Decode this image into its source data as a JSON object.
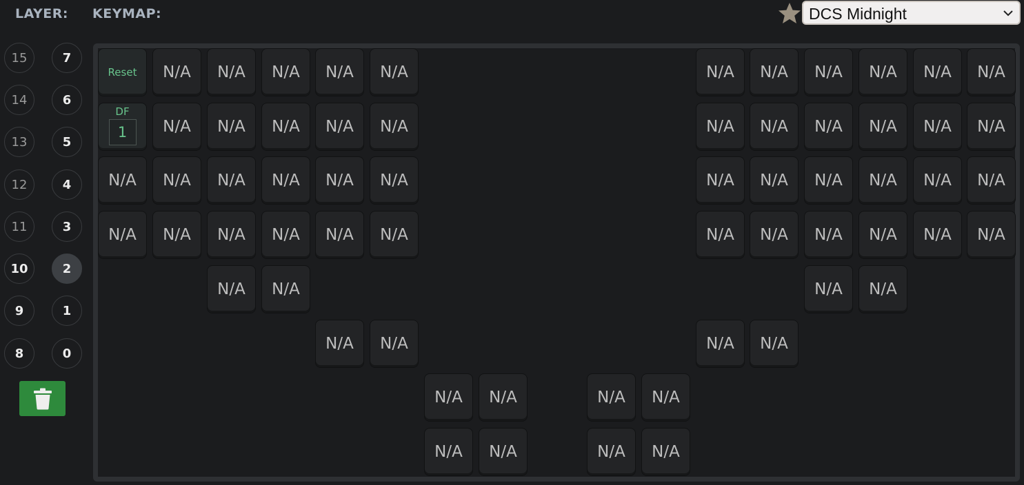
{
  "header": {
    "layer_title": "LAYER:",
    "keymap_title": "KEYMAP:",
    "favorite_icon": "star-icon",
    "theme_selected": "DCS Midnight"
  },
  "layers": {
    "right_column": [
      "7",
      "6",
      "5",
      "4",
      "3",
      "2",
      "1",
      "0"
    ],
    "left_column": [
      "15",
      "14",
      "13",
      "12",
      "11",
      "10",
      "9",
      "8"
    ],
    "active": "2"
  },
  "actions": {
    "clear_icon": "trash-icon"
  },
  "keymap": {
    "reset_label": "Reset",
    "df_label": "DF",
    "df_value": "1",
    "empty_label": "N/A"
  },
  "colors": {
    "background": "#1b1c1e",
    "key": "#232426",
    "accent_green": "#68c48c",
    "trash_button": "#2e8a3c",
    "star": "#9a9080"
  }
}
